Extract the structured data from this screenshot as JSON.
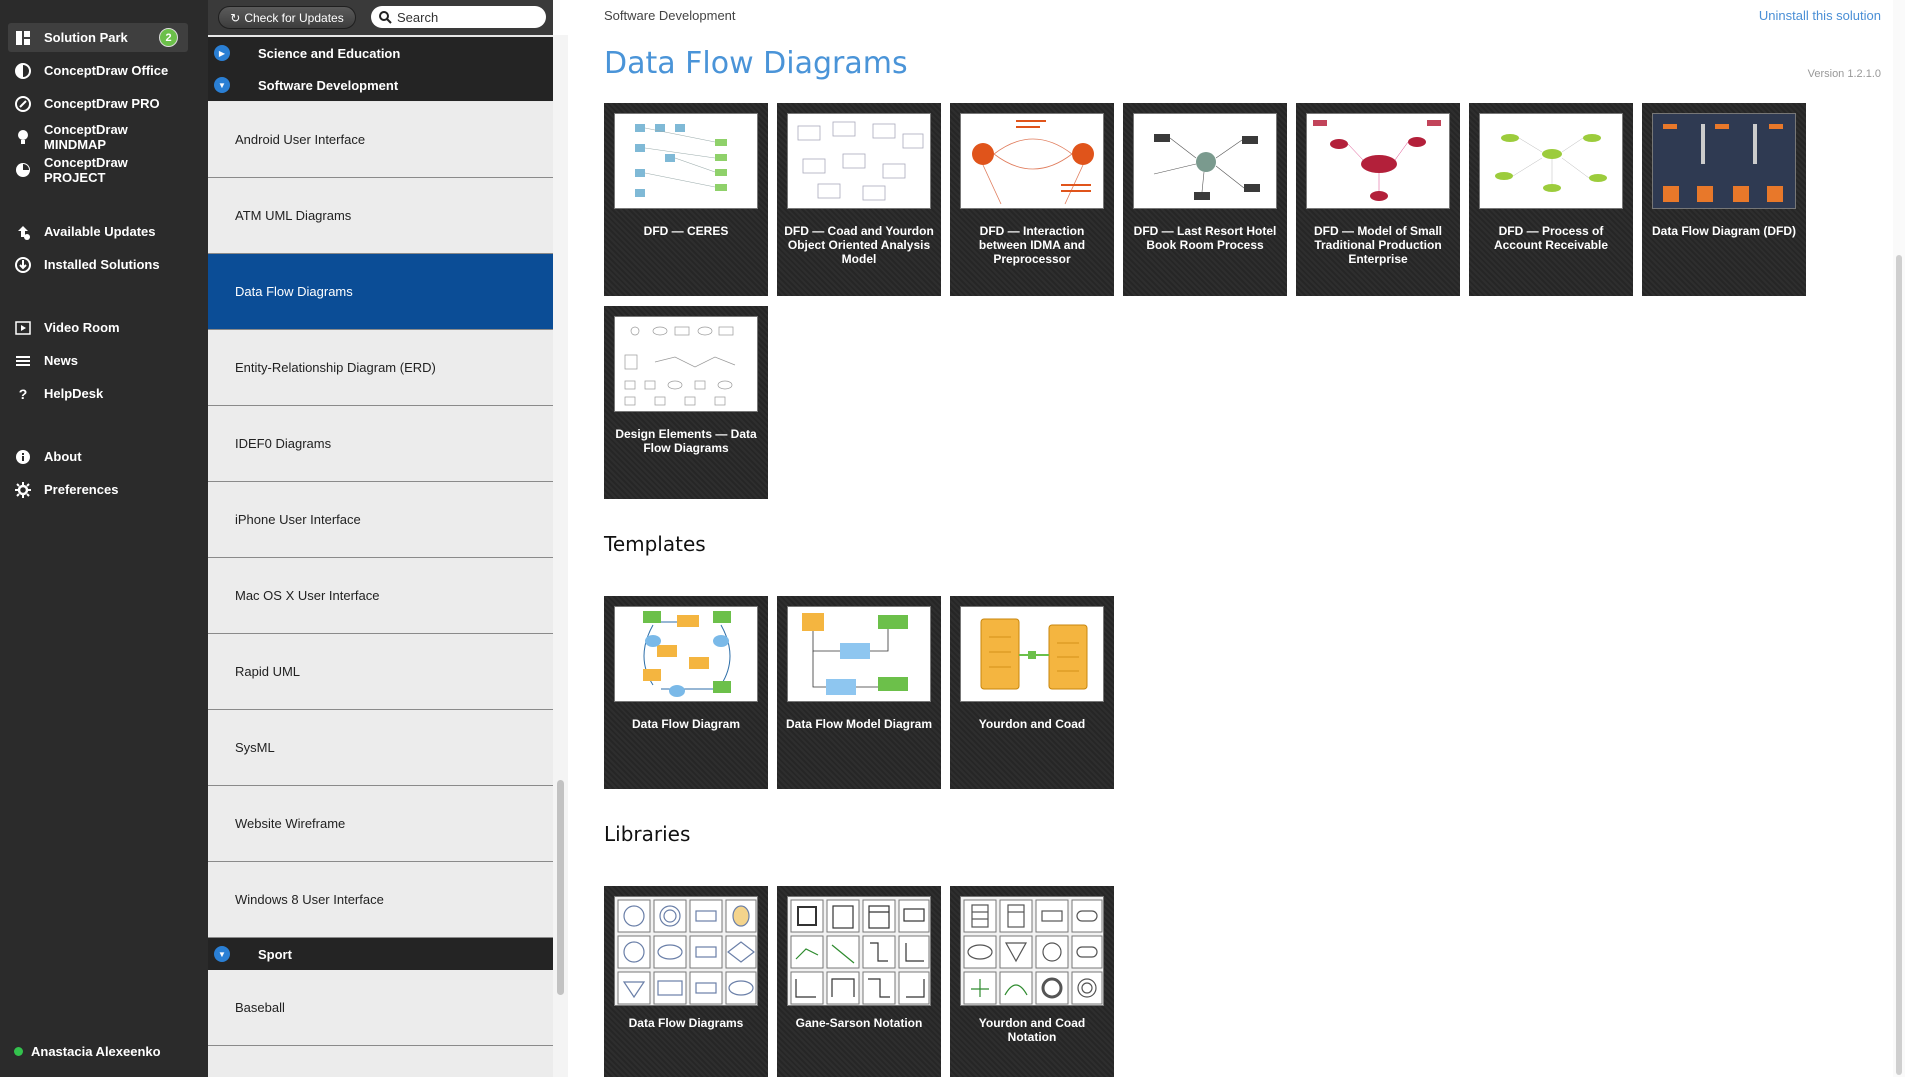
{
  "nav": {
    "items": [
      {
        "label": "Solution Park",
        "icon": "solution-park-icon",
        "badge": "2"
      },
      {
        "label": "ConceptDraw Office",
        "icon": "office-icon"
      },
      {
        "label": "ConceptDraw PRO",
        "icon": "pro-icon"
      },
      {
        "label": "ConceptDraw MINDMAP",
        "icon": "mindmap-icon"
      },
      {
        "label": "ConceptDraw PROJECT",
        "icon": "project-icon"
      },
      {
        "label": "Available Updates",
        "icon": "updates-icon"
      },
      {
        "label": "Installed Solutions",
        "icon": "installed-icon"
      },
      {
        "label": "Video Room",
        "icon": "video-icon"
      },
      {
        "label": "News",
        "icon": "news-icon"
      },
      {
        "label": "HelpDesk",
        "icon": "help-icon"
      },
      {
        "label": "About",
        "icon": "about-icon"
      },
      {
        "label": "Preferences",
        "icon": "gear-icon"
      }
    ],
    "user": "Anastacia Alexeenko"
  },
  "toolbar": {
    "check_updates": "Check for Updates",
    "search_placeholder": "Search"
  },
  "categories": {
    "science": "Science and Education",
    "software": "Software Development",
    "sport": "Sport"
  },
  "solutions": [
    "Android User Interface",
    "ATM UML Diagrams",
    "Data Flow Diagrams",
    "Entity-Relationship Diagram (ERD)",
    "IDEF0 Diagrams",
    "iPhone User Interface",
    "Mac OS X User Interface",
    "Rapid UML",
    "SysML",
    "Website Wireframe",
    "Windows 8 User Interface"
  ],
  "sport_items": [
    "Baseball"
  ],
  "main": {
    "breadcrumb": "Software Development",
    "uninstall": "Uninstall this solution",
    "title": "Data Flow Diagrams",
    "version": "Version 1.2.1.0",
    "examples": [
      "DFD — CERES",
      "DFD — Coad and Yourdon Object Oriented Analysis Model",
      "DFD — Interaction between IDMA and Preprocessor",
      "DFD — Last Resort Hotel Book Room Process",
      "DFD — Model of Small Traditional Production Enterprise",
      "DFD — Process of Account Receivable",
      "Data Flow Diagram (DFD)",
      "Design Elements — Data Flow Diagrams"
    ],
    "templates_title": "Templates",
    "templates": [
      "Data Flow Diagram",
      "Data Flow Model Diagram",
      "Yourdon and Coad"
    ],
    "libraries_title": "Libraries",
    "libraries": [
      "Data Flow Diagrams",
      "Gane-Sarson Notation",
      "Yourdon and Coad Notation"
    ]
  },
  "colors": {
    "accent_blue": "#4a94d8",
    "selected_row": "#0b4d96",
    "badge_green": "#6cc04a",
    "online_green": "#33c24d"
  }
}
